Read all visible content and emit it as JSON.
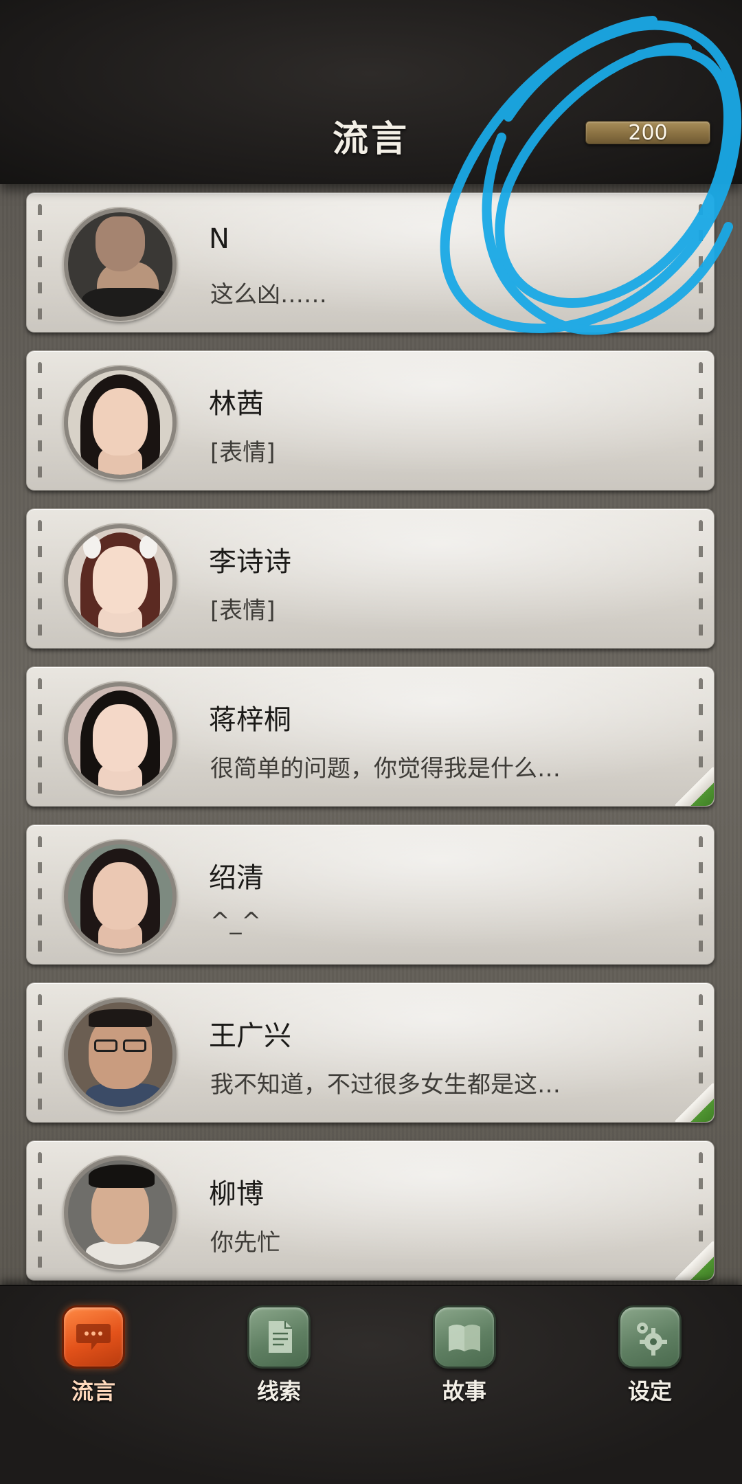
{
  "header": {
    "title": "流言",
    "coins": "200"
  },
  "messages": [
    {
      "name": "N",
      "preview": "这么凶……",
      "unread": false,
      "avatar": "avatar-n"
    },
    {
      "name": "林茜",
      "preview": "[表情]",
      "unread": false,
      "avatar": "avatar-linqian"
    },
    {
      "name": "李诗诗",
      "preview": "[表情]",
      "unread": false,
      "avatar": "avatar-lishishi"
    },
    {
      "name": "蒋梓桐",
      "preview": "很简单的问题，你觉得我是什么…",
      "unread": true,
      "avatar": "avatar-jiangzitong"
    },
    {
      "name": "绍清",
      "preview": "^_^",
      "unread": false,
      "avatar": "avatar-shaoqing"
    },
    {
      "name": "王广兴",
      "preview": "我不知道，不过很多女生都是这…",
      "unread": true,
      "avatar": "avatar-wangguangxing"
    },
    {
      "name": "柳博",
      "preview": "你先忙",
      "unread": true,
      "avatar": "avatar-liubo"
    }
  ],
  "nav": {
    "items": [
      {
        "label": "流言",
        "icon": "chat-bubble-icon",
        "active": true
      },
      {
        "label": "线索",
        "icon": "document-icon",
        "active": false
      },
      {
        "label": "故事",
        "icon": "book-icon",
        "active": false
      },
      {
        "label": "设定",
        "icon": "gear-icon",
        "active": false
      }
    ]
  },
  "colors": {
    "accent": "#e3521a",
    "nav_inactive": "#5f7f62",
    "unread_flag": "#5ba33a",
    "annotation": "#1aa9e6"
  }
}
